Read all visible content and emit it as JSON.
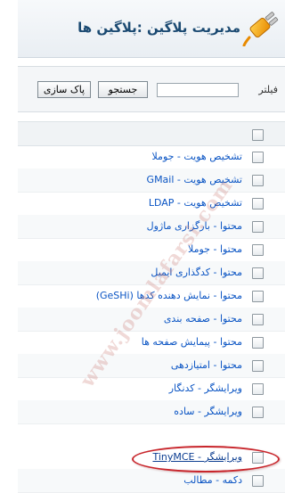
{
  "header": {
    "title": "مدیریت پلاگین :پلاگین ها",
    "icon": "plug-icon"
  },
  "filter": {
    "label": "فیلتر",
    "value": "",
    "search_button": "جستجو",
    "reset_button": "پاک سازی"
  },
  "plugins": [
    {
      "label": "تشخیص هویت - جوملا"
    },
    {
      "label": "تشخیص هویت - GMail"
    },
    {
      "label": "تشخیص هویت - LDAP"
    },
    {
      "label": "محتوا - بارگزاری ماژول"
    },
    {
      "label": "محتوا - جوملا"
    },
    {
      "label": "محتوا - کدگذاری ایمیل"
    },
    {
      "label": "محتوا - نمایش دهنده کدها (GeSHi)"
    },
    {
      "label": "محتوا - صفحه بندی"
    },
    {
      "label": "محتوا - پیمایش صفحه ها"
    },
    {
      "label": "محتوا - امتیازدهی"
    },
    {
      "label": "ویرایشگر - کدنگار"
    },
    {
      "label": "ویرایشگر - ساده"
    },
    {
      "label": "ویرایشگر - TinyMCE",
      "highlighted": true
    },
    {
      "label": "دکمه - مطالب"
    }
  ],
  "watermark": "www.joomlafarsi.com",
  "colors": {
    "link": "#0b55c4",
    "title": "#1b4a72",
    "highlight": "#c8252b"
  }
}
